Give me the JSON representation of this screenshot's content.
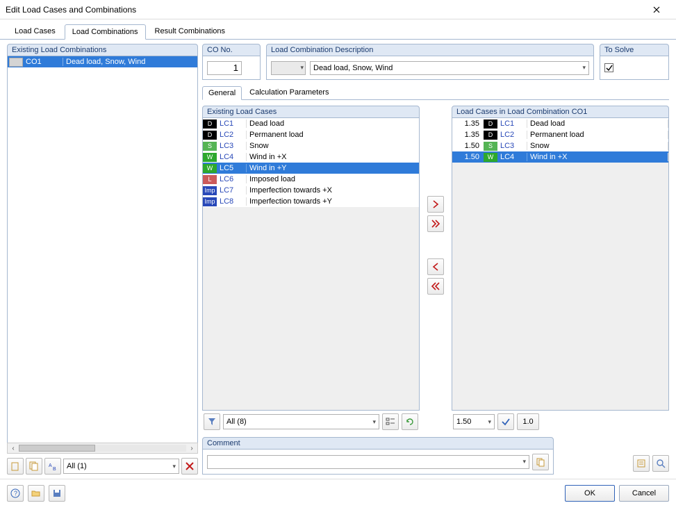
{
  "window": {
    "title": "Edit Load Cases and Combinations"
  },
  "main_tabs": {
    "load_cases": "Load Cases",
    "load_combinations": "Load Combinations",
    "result_combinations": "Result Combinations"
  },
  "left": {
    "header": "Existing Load Combinations",
    "rows": [
      {
        "id": "CO1",
        "desc": "Dead load, Snow, Wind",
        "selected": true
      }
    ],
    "filter_label": "All (1)"
  },
  "fields": {
    "co_no": {
      "label": "CO No.",
      "value": "1"
    },
    "desc": {
      "label": "Load Combination Description",
      "category": "",
      "value": "Dead load, Snow, Wind"
    },
    "to_solve": {
      "label": "To Solve",
      "checked": true
    }
  },
  "sub_tabs": {
    "general": "General",
    "calc_params": "Calculation Parameters"
  },
  "existing_lc": {
    "header": "Existing Load Cases",
    "rows": [
      {
        "cat": "D",
        "id": "LC1",
        "desc": "Dead load"
      },
      {
        "cat": "D",
        "id": "LC2",
        "desc": "Permanent load"
      },
      {
        "cat": "S",
        "id": "LC3",
        "desc": "Snow"
      },
      {
        "cat": "W",
        "id": "LC4",
        "desc": "Wind in +X"
      },
      {
        "cat": "W",
        "id": "LC5",
        "desc": "Wind in +Y",
        "selected": true
      },
      {
        "cat": "L",
        "id": "LC6",
        "desc": "Imposed load"
      },
      {
        "cat": "Imp",
        "id": "LC7",
        "desc": "Imperfection towards +X"
      },
      {
        "cat": "Imp",
        "id": "LC8",
        "desc": "Imperfection towards +Y"
      }
    ],
    "filter_label": "All (8)"
  },
  "combo_lc": {
    "header": "Load Cases in Load Combination CO1",
    "rows": [
      {
        "factor": "1.35",
        "cat": "D",
        "id": "LC1",
        "desc": "Dead load"
      },
      {
        "factor": "1.35",
        "cat": "D",
        "id": "LC2",
        "desc": "Permanent load"
      },
      {
        "factor": "1.50",
        "cat": "S",
        "id": "LC3",
        "desc": "Snow"
      },
      {
        "factor": "1.50",
        "cat": "W",
        "id": "LC4",
        "desc": "Wind in +X",
        "selected": true
      }
    ],
    "factor_input": "1.50",
    "reset_label": "1.0"
  },
  "comment": {
    "label": "Comment",
    "value": ""
  },
  "buttons": {
    "ok": "OK",
    "cancel": "Cancel"
  }
}
